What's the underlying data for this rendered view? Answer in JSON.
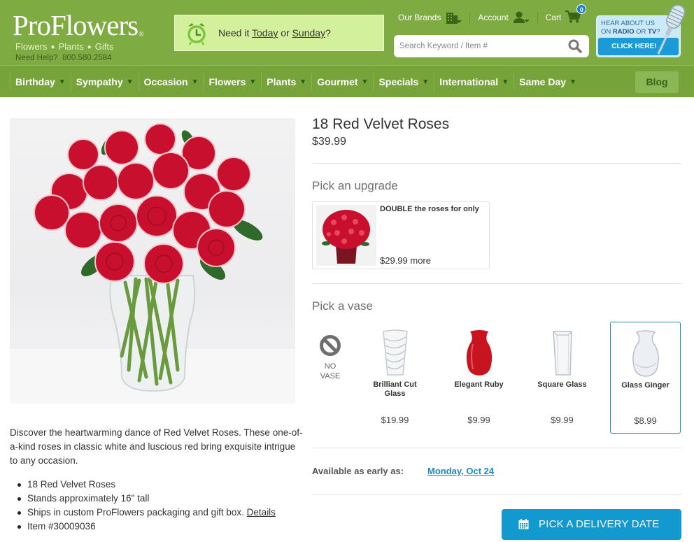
{
  "header": {
    "logo": "ProFlowers",
    "logo_mark": "®",
    "tagline": [
      "Flowers",
      "Plants",
      "Gifts"
    ],
    "help_label": "Need Help?",
    "help_phone": "800.580.2584",
    "promo": {
      "icon": "alarm-clock-icon",
      "prefix": "Need it ",
      "link1": "Today",
      "middle": " or ",
      "link2": "Sunday",
      "suffix": "?"
    },
    "top_links": {
      "brands": "Our Brands",
      "account": "Account",
      "cart": "Cart",
      "cart_count": "0"
    },
    "search": {
      "placeholder": "Search Keyword / Item #",
      "value": ""
    },
    "radio_banner": {
      "line1": "HEAR ABOUT US",
      "line2_prefix": "ON ",
      "line2_radio": "RADIO",
      "line2_or": " OR ",
      "line2_tv": "TV",
      "line2_suffix": "?",
      "cta": "CLICK HERE!"
    }
  },
  "nav": {
    "items": [
      "Birthday",
      "Sympathy",
      "Occasion",
      "Flowers",
      "Plants",
      "Gourmet",
      "Specials",
      "International",
      "Same Day"
    ],
    "caret": "▼",
    "blog": "Blog"
  },
  "product": {
    "title": "18 Red Velvet Roses",
    "price": "$39.99",
    "description": "Discover the heartwarming dance of Red Velvet Roses. These one-of-a-kind roses in classic white and luscious red bring exquisite intrigue to any occasion.",
    "bullets": {
      "b1": "18 Red Velvet Roses",
      "b2": "Stands approximately 16\" tall",
      "b3": "Ships in custom ProFlowers packaging and gift box. ",
      "b3_link": "Details",
      "b4": "Item #30009036"
    }
  },
  "upgrade": {
    "heading": "Pick an upgrade",
    "title": "DOUBLE the roses for only",
    "price": "$29.99 more"
  },
  "vase": {
    "heading": "Pick a vase",
    "none_label_1": "NO",
    "none_label_2": "VASE",
    "options": [
      {
        "name": "Brilliant Cut Glass",
        "price": "$19.99",
        "selected": false
      },
      {
        "name": "Elegant Ruby",
        "price": "$9.99",
        "selected": false
      },
      {
        "name": "Square Glass",
        "price": "$9.99",
        "selected": false
      },
      {
        "name": "Glass Ginger",
        "price": "$8.99",
        "selected": true
      }
    ]
  },
  "availability": {
    "label": "Available as early as:",
    "date": "Monday, Oct 24"
  },
  "cta": {
    "label": "PICK A DELIVERY DATE"
  },
  "colors": {
    "header_green": "#7eab42",
    "nav_green": "#76a33a",
    "promo_bg": "#d3f09c",
    "accent_blue": "#1299cf",
    "link_blue": "#1a8ac8",
    "selected_border": "#2b8fb3"
  }
}
